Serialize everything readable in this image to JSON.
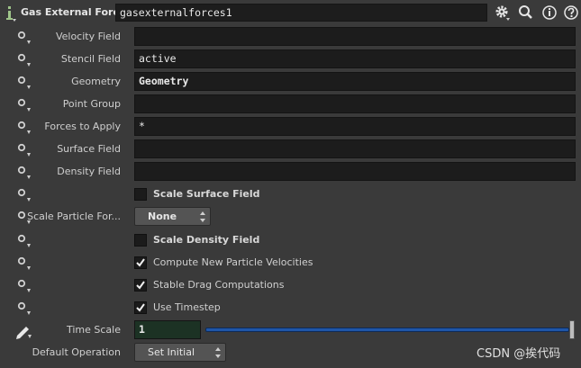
{
  "header": {
    "node_type": "Gas External Forces",
    "node_name": "gasexternalforces1"
  },
  "params": {
    "velocity_field": {
      "label": "Velocity Field",
      "value": ""
    },
    "stencil_field": {
      "label": "Stencil Field",
      "value": "active"
    },
    "geometry": {
      "label": "Geometry",
      "value": "Geometry"
    },
    "point_group": {
      "label": "Point Group",
      "value": ""
    },
    "forces_to_apply": {
      "label": "Forces to Apply",
      "value": "*"
    },
    "surface_field": {
      "label": "Surface Field",
      "value": ""
    },
    "density_field": {
      "label": "Density Field",
      "value": ""
    },
    "scale_surface_field": {
      "label": "Scale Surface Field",
      "checked": false
    },
    "scale_particle_force": {
      "label": "Scale Particle For...",
      "selected": "None"
    },
    "scale_density_field": {
      "label": "Scale Density Field",
      "checked": false
    },
    "compute_new_particle_velocities": {
      "label": "Compute New Particle Velocities",
      "checked": true
    },
    "stable_drag_computations": {
      "label": "Stable Drag Computations",
      "checked": true
    },
    "use_timestep": {
      "label": "Use Timestep",
      "checked": true
    },
    "time_scale": {
      "label": "Time Scale",
      "value": "1",
      "slider_fraction": 1.0
    },
    "default_operation": {
      "label": "Default Operation",
      "selected": "Set Initial"
    }
  },
  "icons": {
    "info": "info-icon",
    "gear": "gear-icon",
    "search": "search-icon",
    "help_info": "info-circle-icon",
    "help": "help-icon"
  },
  "watermark": "CSDN @挨代码",
  "colors": {
    "slider_fill": "#1f56a8",
    "time_field_bg": "#1c3224"
  }
}
